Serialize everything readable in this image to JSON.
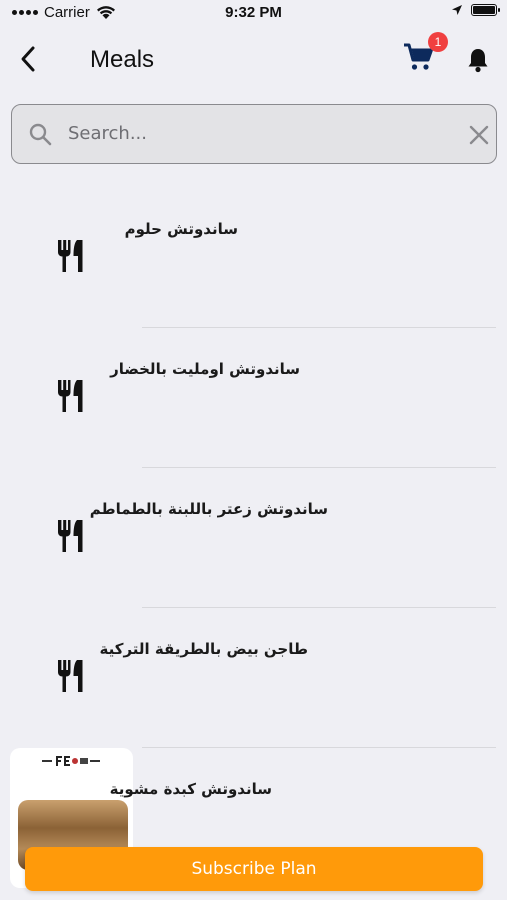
{
  "status_bar": {
    "carrier": "Carrier",
    "time": "9:32 PM",
    "icons": [
      "signal-dots-icon",
      "wifi-icon",
      "location-arrow-icon",
      "battery-icon"
    ]
  },
  "nav": {
    "title": "Meals",
    "back_icon": "chevron-left-icon",
    "cart_icon": "cart-icon",
    "cart_count": "1",
    "bell_icon": "bell-icon"
  },
  "search": {
    "placeholder": "Search...",
    "value": "",
    "search_icon": "search-icon",
    "clear_icon": "close-icon"
  },
  "meals": [
    {
      "name": "ساندوتش حلوم",
      "thumb_icon": "utensils-icon"
    },
    {
      "name": "ساندوتش اومليت بالخضار",
      "thumb_icon": "utensils-icon"
    },
    {
      "name": "ساندوتش زعتر باللبنة بالطماطم",
      "thumb_icon": "utensils-icon"
    },
    {
      "name": "طاجن بيض بالطريقة التركية",
      "thumb_icon": "utensils-icon"
    },
    {
      "name": "ساندوتش كبدة مشوية",
      "thumb_icon": "food-photo"
    }
  ],
  "footer": {
    "subscribe_label": "Subscribe Plan"
  },
  "colors": {
    "background": "#EFEFF4",
    "accent": "#FF9A0A",
    "badge": "#F04040"
  }
}
